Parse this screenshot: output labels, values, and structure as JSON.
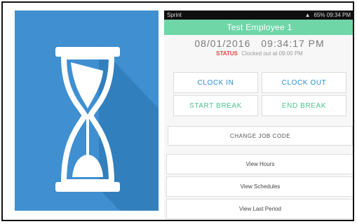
{
  "statusbar": {
    "carrier": "Sprint",
    "right_text": "65% 09:34 PM"
  },
  "app": {
    "title": "Test Employee 1",
    "date": "08/01/2016",
    "time": "09:34:17 PM",
    "status_label": "STATUS",
    "status_text": "Clocked out at 09:00 PM"
  },
  "buttons": {
    "clock_in": "CLOCK IN",
    "clock_out": "CLOCK OUT",
    "start_break": "START BREAK",
    "end_break": "END BREAK",
    "change_job_code": "CHANGE JOB CODE"
  },
  "menu": [
    {
      "label": "View Hours"
    },
    {
      "label": "View Schedules"
    },
    {
      "label": "View Last Period"
    }
  ],
  "colors": {
    "icon_bg": "#3f8fd1",
    "accent_green": "#6fd6a8",
    "accent_blue": "#2a8bd0",
    "status_red": "#e0473e"
  },
  "icons": {
    "left_panel": "hourglass-icon"
  }
}
